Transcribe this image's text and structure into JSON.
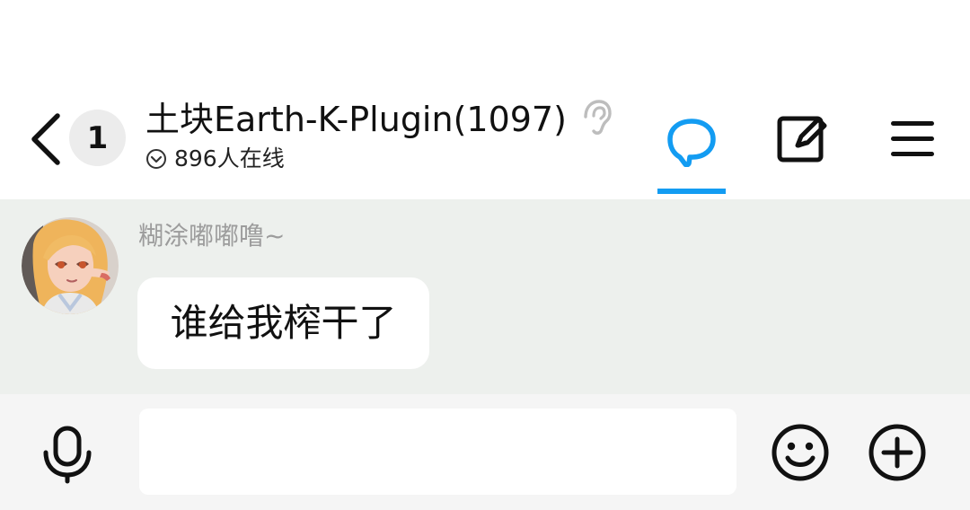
{
  "header": {
    "back_icon": "chevron-left-icon",
    "unread_count": "1",
    "title": "土块Earth-K-Plugin(1097)",
    "ear_icon": "ear-icon",
    "online_text": "896人在线",
    "online_icon": "chevron-down-circle-icon",
    "tabs": [
      {
        "icon": "speech-bubble-icon",
        "active": true
      },
      {
        "icon": "edit-square-icon",
        "active": false
      },
      {
        "icon": "menu-icon",
        "active": false
      }
    ]
  },
  "messages": [
    {
      "sender": "糊涂嘟嘟噜~",
      "avatar_icon": "avatar-anime-girl",
      "text": "谁给我榨干了"
    }
  ],
  "composer": {
    "placeholder": "",
    "value": "",
    "voice_icon": "microphone-icon",
    "emoji_icon": "smiley-icon",
    "plus_icon": "plus-circle-icon"
  },
  "colors": {
    "accent": "#139cf2",
    "message_area_bg": "#edf0ed",
    "input_bar_bg": "#f5f5f5",
    "badge_bg": "#ececec",
    "sender_text": "#9c9c9c"
  }
}
